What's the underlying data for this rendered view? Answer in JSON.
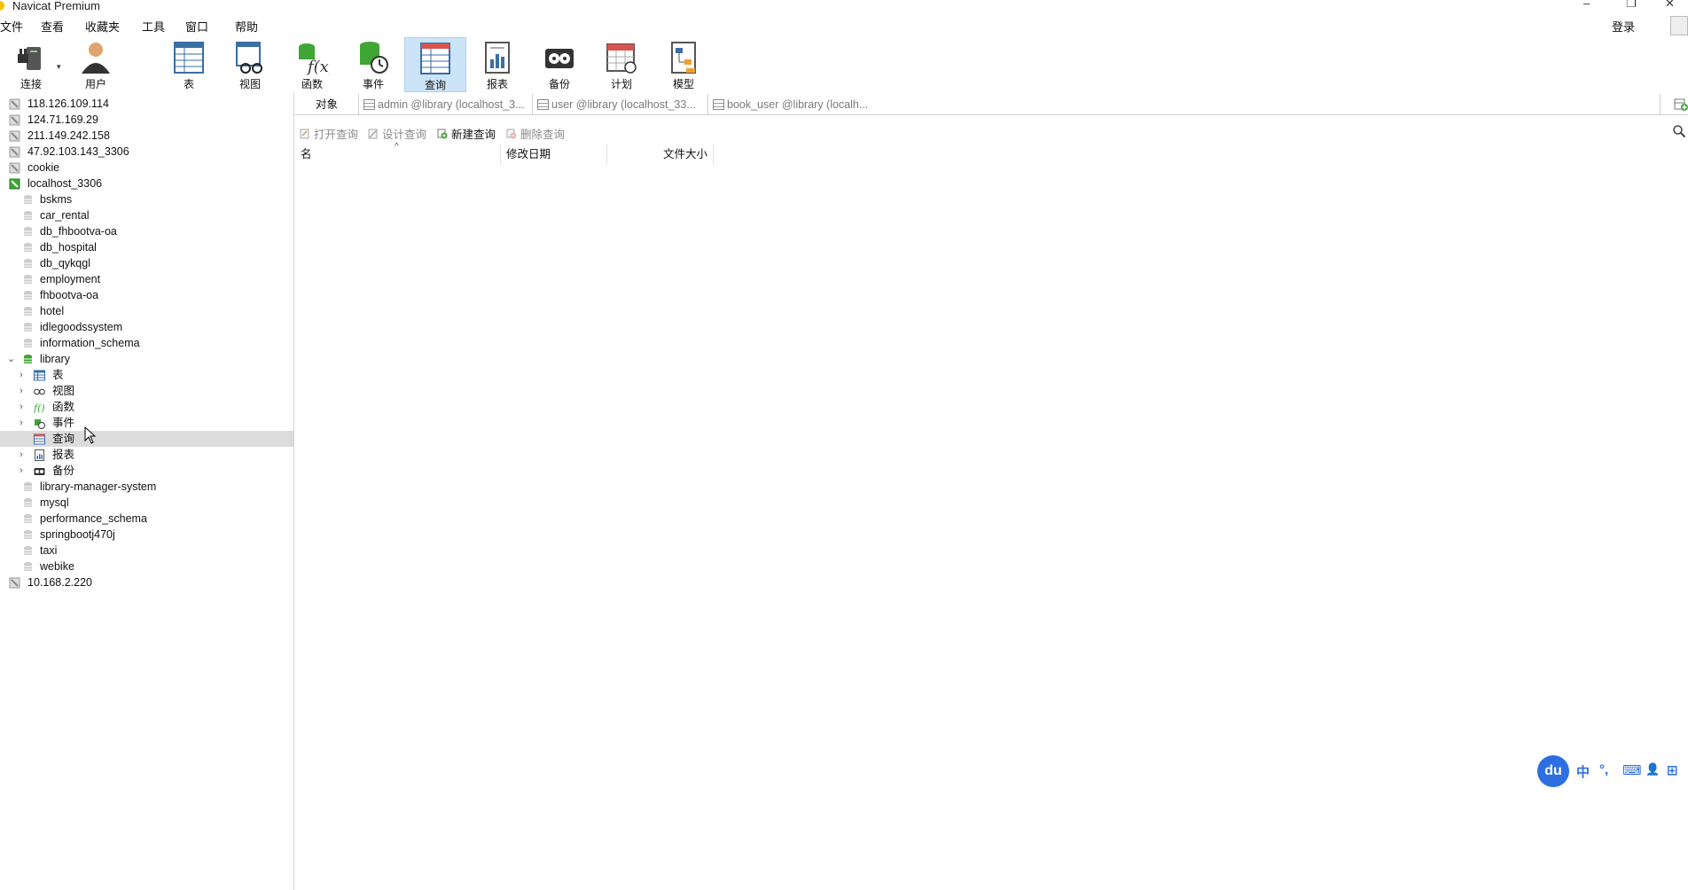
{
  "window": {
    "title": "Navicat Premium",
    "minimize": "–",
    "restore": "❐",
    "close": "✕"
  },
  "menu": {
    "items": [
      "文件",
      "查看",
      "收藏夹",
      "工具",
      "窗口",
      "帮助"
    ],
    "login": "登录"
  },
  "toolbar": {
    "connect": "连接",
    "user": "用户",
    "table": "表",
    "view": "视图",
    "function": "函数",
    "event": "事件",
    "query": "查询",
    "report": "报表",
    "backup": "备份",
    "schedule": "计划",
    "model": "模型",
    "dropdown_glyph": "▾"
  },
  "tree": {
    "connections_top": [
      "118.126.109.114",
      "124.71.169.29",
      "211.149.242.158",
      "47.92.103.143_3306",
      "cookie"
    ],
    "active_connection": "localhost_3306",
    "databases_before": [
      "bskms",
      "car_rental",
      "db_fhbootva-oa",
      "db_hospital",
      "db_qykqgl",
      "employment",
      "fhbootva-oa",
      "hotel",
      "idlegoodssystem",
      "information_schema"
    ],
    "open_database": "library",
    "library_children": [
      "表",
      "视图",
      "函数",
      "事件",
      "查询",
      "报表",
      "备份"
    ],
    "databases_after": [
      "library-manager-system",
      "mysql",
      "performance_schema",
      "springbootj470j",
      "taxi",
      "webike"
    ],
    "connections_bottom": [
      "10.168.2.220"
    ]
  },
  "tabs": {
    "objects": "对象",
    "items": [
      "admin @library (localhost_3...",
      "user @library (localhost_33...",
      "book_user @library (localh..."
    ]
  },
  "actions": {
    "open": "打开查询",
    "design": "设计查询",
    "new": "新建查询",
    "delete": "删除查询"
  },
  "columns": {
    "name": "名",
    "modified": "修改日期",
    "size": "文件大小",
    "sort_glyph": "^"
  },
  "ime": {
    "logo": "du",
    "items": [
      "中",
      "°,",
      "⌨",
      "👤",
      "⊞"
    ]
  },
  "colors": {
    "accent_active": "#cce4f7",
    "selection": "#dcdcdc",
    "db_green": "#3fa535",
    "ime_blue": "#2d6fe0"
  }
}
